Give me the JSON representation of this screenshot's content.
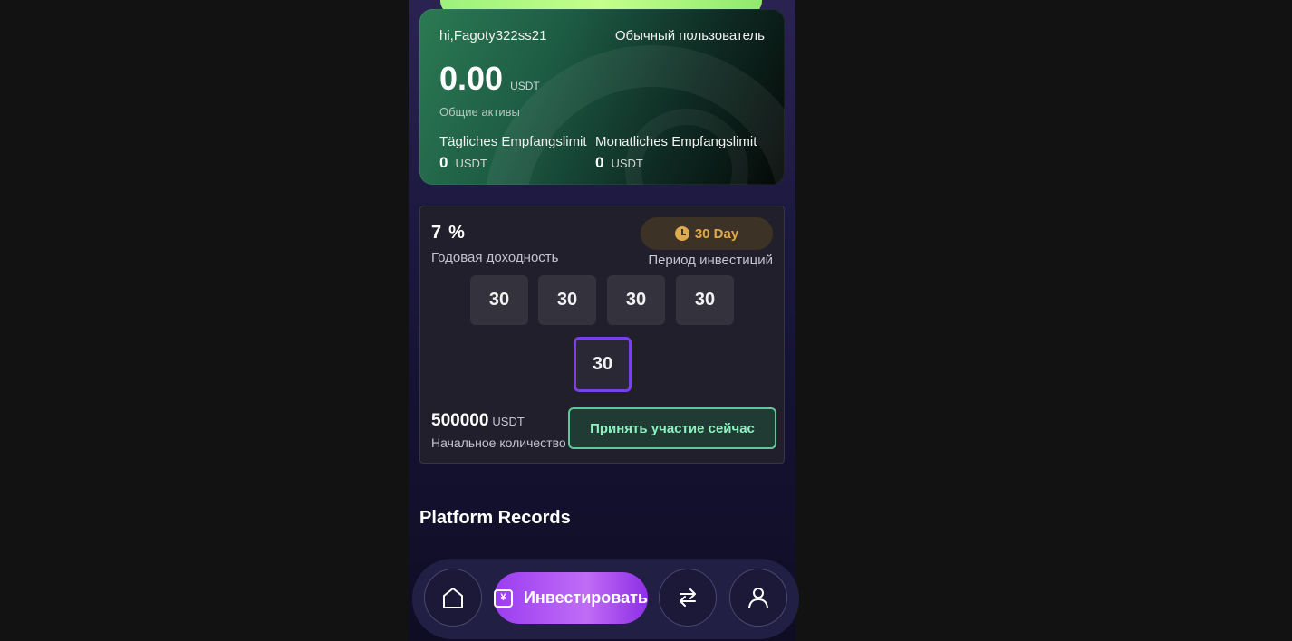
{
  "asset_card": {
    "greeting": "hi,Fagoty322ss21",
    "user_level": "Обычный пользователь",
    "total_value": "0.00",
    "total_unit": "USDT",
    "total_label": "Общие активы",
    "daily_limit_title": "Tägliches Empfangslimit",
    "daily_limit_value": "0",
    "daily_limit_unit": "USDT",
    "monthly_limit_title": "Monatliches Empfangslimit",
    "monthly_limit_value": "0",
    "monthly_limit_unit": "USDT"
  },
  "invest_card": {
    "rate_value": "7",
    "rate_percent": "%",
    "rate_label": "Годовая доходность",
    "period_badge": "30  Day",
    "period_label": "Период инвестиций",
    "day_options": [
      "30",
      "30",
      "30",
      "30",
      "30"
    ],
    "selected_index": 4,
    "amount_value": "500000",
    "amount_unit": "USDT",
    "amount_label": "Начальное количество",
    "join_button": "Принять участие сейчас"
  },
  "records_title": "Platform Records",
  "bottom_nav": {
    "invest_label": "Инвестировать",
    "home_icon": "home-icon",
    "exchange_icon": "exchange-icon",
    "profile_icon": "profile-icon"
  },
  "colors": {
    "accent_purple": "#9b3df0",
    "green_button_border": "#5fc79a",
    "badge_gold": "#e0a94e"
  }
}
